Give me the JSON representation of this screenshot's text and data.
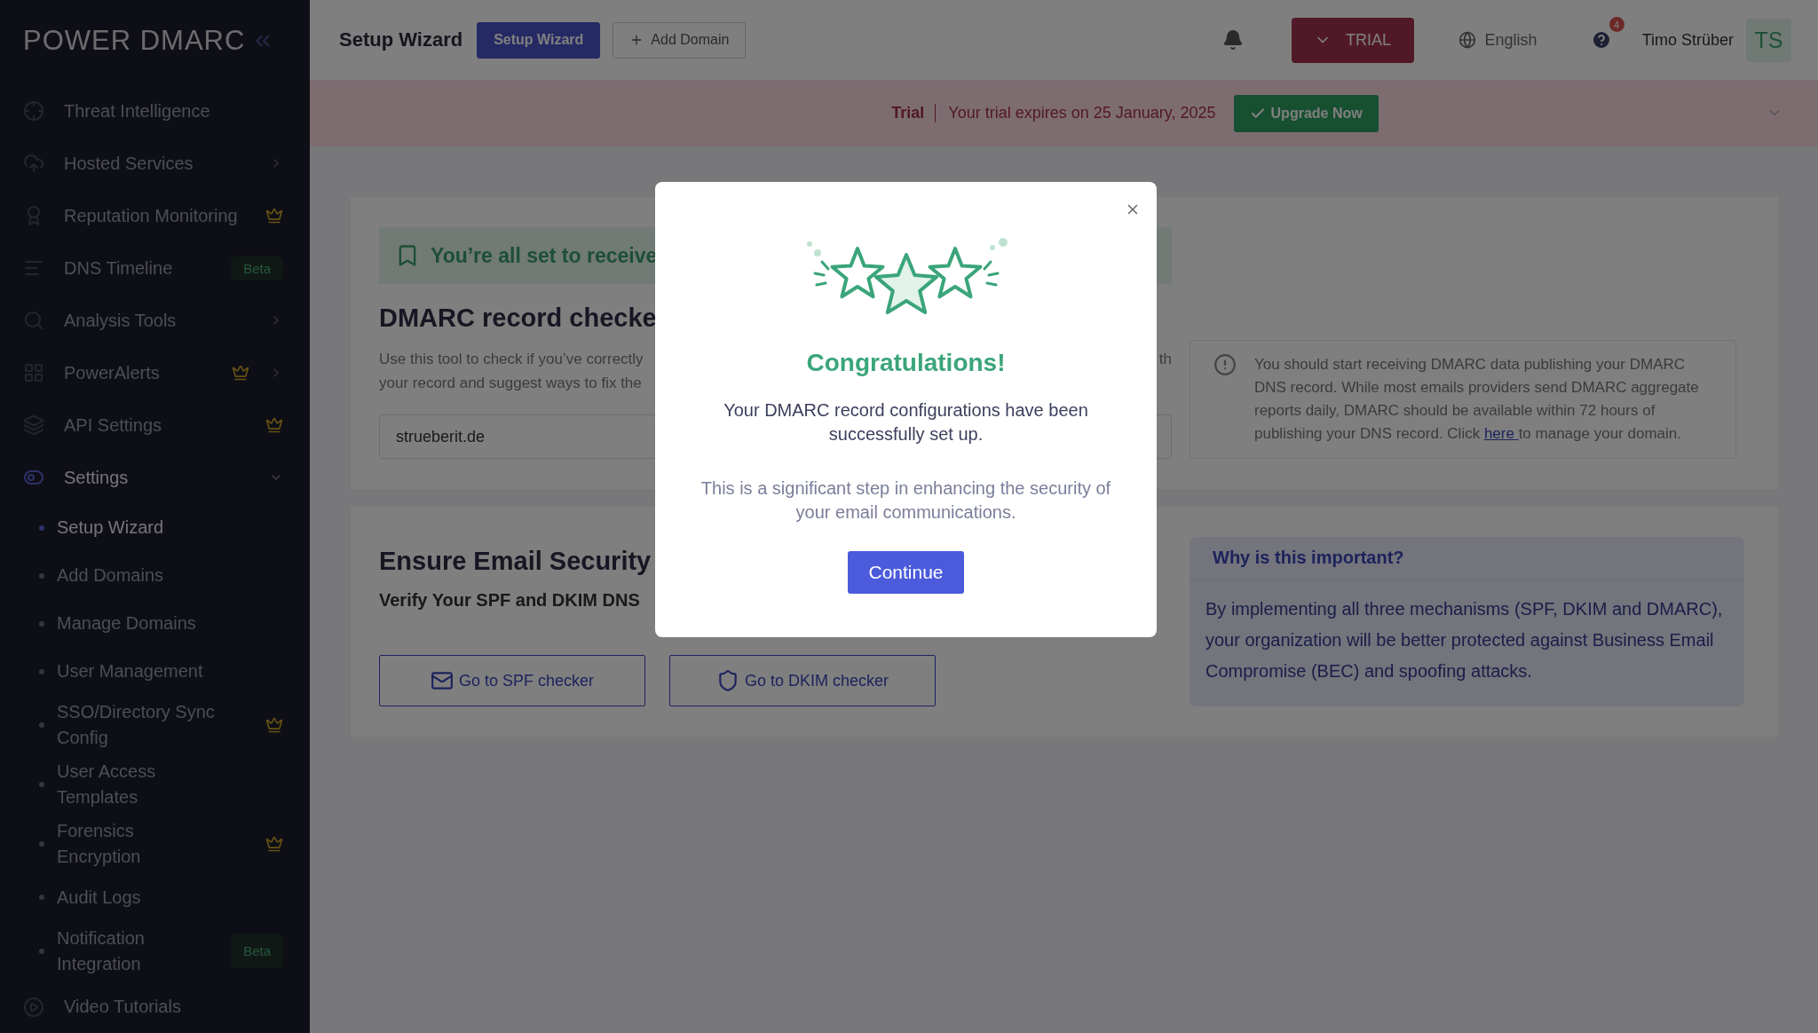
{
  "sidebar": {
    "logo": "POWER DMARC",
    "items": [
      {
        "label": "Threat Intelligence",
        "selected": false
      },
      {
        "label": "Hosted Services",
        "selected": false,
        "has_submenu": true
      },
      {
        "label": "Reputation Monitoring",
        "selected": false,
        "premium": true
      },
      {
        "label": "DNS Timeline",
        "selected": false,
        "badge": "Beta"
      },
      {
        "label": "Analysis Tools",
        "selected": false,
        "has_submenu": true
      },
      {
        "label": "PowerAlerts",
        "selected": false,
        "premium": true,
        "has_submenu": true
      },
      {
        "label": "API Settings",
        "selected": false,
        "premium": true
      },
      {
        "label": "Settings",
        "selected": true,
        "has_submenu": true,
        "expanded": true,
        "children": [
          {
            "label": "Setup Wizard",
            "selected": true
          },
          {
            "label": "Add Domains",
            "selected": false
          },
          {
            "label": "Manage Domains",
            "selected": false
          },
          {
            "label": "User Management",
            "selected": false
          },
          {
            "label": "SSO/Directory Sync Config",
            "selected": false,
            "premium": true
          },
          {
            "label": "User Access Templates",
            "selected": false
          },
          {
            "label": "Forensics Encryption",
            "selected": false,
            "premium": true
          },
          {
            "label": "Audit Logs",
            "selected": false
          },
          {
            "label": "Notification Integration",
            "selected": false,
            "badge": "Beta"
          }
        ]
      },
      {
        "label": "Video Tutorials",
        "selected": false
      }
    ]
  },
  "header": {
    "title": "Setup Wizard",
    "buttons": [
      {
        "label": "Setup Wizard",
        "kind": "primary"
      },
      {
        "label": "Add Domain",
        "kind": "outline"
      }
    ],
    "trial_button": "TRIAL",
    "language": "English",
    "help_badge": "4",
    "user_name": "Timo Strüber",
    "avatar_initials": "TS"
  },
  "trial_banner": {
    "label": "Trial",
    "message": "Your trial expires on 25 January, 2025",
    "button": "Upgrade Now"
  },
  "checker_card": {
    "banner_text": "You’re all set to receive",
    "title": "DMARC record checke",
    "description_lines": [
      "Use this tool to check if you’ve correctly",
      "your record and suggest ways to fix the"
    ],
    "description_fragment": "th",
    "domain_value": "strueberit.de",
    "info": {
      "text_before": "You should start receiving DMARC data publishing your DMARC DNS record. While most emails providers send DMARC aggregate reports daily, DMARC should be available within 72 hours of publishing your DNS record. Click ",
      "link": "here ",
      "text_after": "to manage your domain."
    }
  },
  "security_card": {
    "title": "Ensure Email Security",
    "subtitle": "Verify Your SPF and DKIM DNS",
    "buttons": [
      "Go to SPF checker",
      "Go to DKIM checker"
    ],
    "why": {
      "title": "Why is this important?",
      "text": "By implementing all three mechanisms (SPF, DKIM and DMARC), your organization will be better protected against Business Email Compromise (BEC) and spoofing attacks."
    }
  },
  "modal": {
    "title": "Congratulations!",
    "message": "Your DMARC record configurations have been successfully set up.",
    "note": "This is a significant step in enhancing the security of your email communications.",
    "button": "Continue"
  }
}
